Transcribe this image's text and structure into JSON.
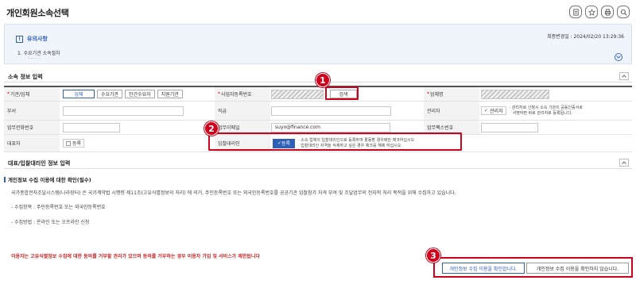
{
  "page": {
    "title": "개인회원소속선택"
  },
  "toolbar": {
    "icons": [
      "doc-icon",
      "star-icon",
      "print-icon",
      "search-icon"
    ]
  },
  "notice": {
    "title": "유의사항",
    "item": "1. 수요기관 소속절차",
    "dots": "......",
    "updated": "최종변경일 : 2024/02/20 13:29:36"
  },
  "affiliation": {
    "section_title": "소속 정보 입력",
    "labels": {
      "org_type": "기관/업체",
      "biz_reg_no": "사업자등록번호",
      "company_name": "업체명",
      "dept": "부서",
      "position": "직급",
      "manager": "관리자",
      "work_phone": "업무전화번호",
      "work_email": "업무이메일",
      "work_fax": "업무팩스번호",
      "representative": "대표자",
      "bid_agent": "입찰대리인"
    },
    "org_types": [
      "업체",
      "수요기관",
      "민간수요자",
      "지원기관"
    ],
    "search_label": "검색",
    "email_value": "suyo@finance.com",
    "manager_check": "관리자",
    "manager_note1": "· 관리자로 신청시 소속 기관의 공동인증서로",
    "manager_note2": "서명하면 바로 관리자로 등록됩니다.",
    "rep_check": "등록",
    "agent_check": "등록",
    "agent_note1": "· 소속 업체의 입찰대리인으로 등록하여 활동할 경우에만 체크하십시오",
    "agent_note2": "· 입찰대리인 자격을 삭제하고 싶은 경우 체크를 해제 하십시오."
  },
  "consent": {
    "section_title": "대표/입찰대리인 정보 입력",
    "sub_title": "개인정보 수집 이용에 대한 확인(필수)",
    "text1": "국가종합전자조달시스템(나라장터) 은 국가계약법 시행령 제11조(고유식별정보의 처리) 에 의거, 주민등록번호 또는 외국인등록번호를 공공기관 입찰참가 자격 부여 및 조달업무의 전자적 처리 목적을 위해 수집하고 있습니다.",
    "text2": "- 수집항목 : 주민등록번호 또는 외국인등록번호",
    "text3": "- 수집방법 : 온라인 또는 오프라인 신청",
    "warn": "이용자는 고유식별정보 수집에 대한 동의를 거부할 권리가 있으며 동의를 거부하는 경우 이용자 가입 및 서비스가 제한됩니다",
    "agree": "개인정보 수집 이용을 확인합니다.",
    "disagree": "개인정보 수집 이용을 확인하지 않습니다."
  },
  "markers": [
    "1",
    "2",
    "3"
  ],
  "colors": {
    "accent": "#2f5fb8",
    "highlight": "#d0021b"
  }
}
